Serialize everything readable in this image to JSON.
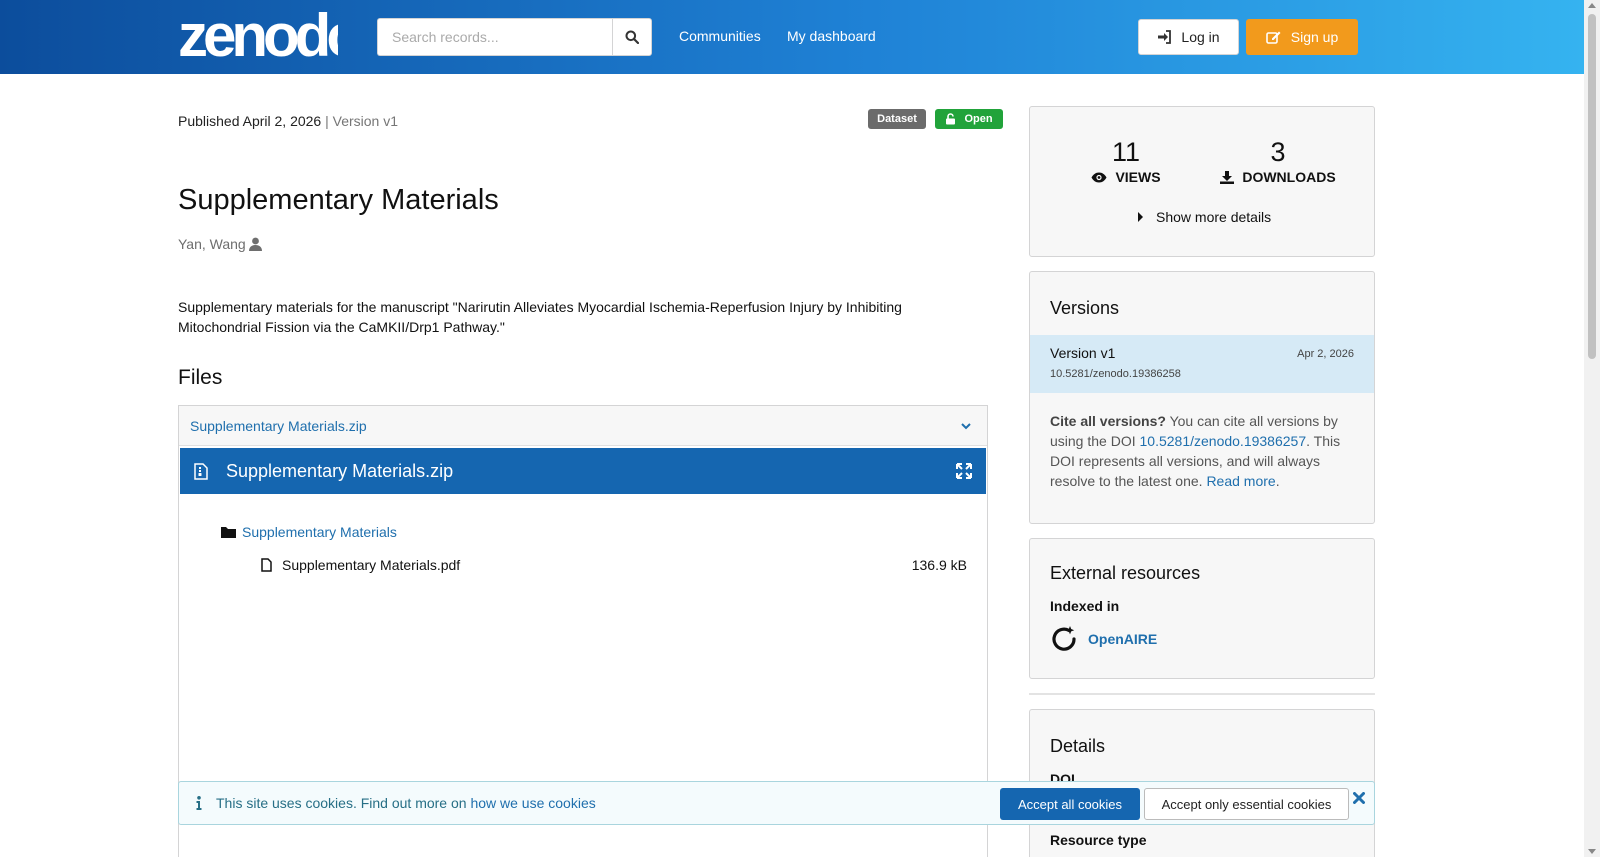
{
  "header": {
    "logo_text": "zenodo",
    "search_placeholder": "Search records...",
    "nav": [
      "Communities",
      "My dashboard"
    ],
    "login_label": "Log in",
    "signup_label": "Sign up"
  },
  "record": {
    "published_label": "Published April 2, 2026",
    "version_label": "| Version v1",
    "type_badge": "Dataset",
    "access_badge": "Open",
    "title": "Supplementary Materials",
    "author": "Yan, Wang",
    "description": "Supplementary materials for the manuscript \"Narirutin Alleviates Myocardial Ischemia-Reperfusion Injury by Inhibiting Mitochondrial Fission via the CaMKII/Drp1 Pathway.\""
  },
  "files": {
    "heading": "Files",
    "archive_name": "Supplementary Materials.zip",
    "preview_title": "Supplementary Materials.zip",
    "folder_name": "Supplementary Materials",
    "file_name": "Supplementary Materials.pdf",
    "file_size": "136.9 kB"
  },
  "stats": {
    "views_count": "11",
    "views_label": "VIEWS",
    "downloads_count": "3",
    "downloads_label": "DOWNLOADS",
    "more_details_label": "Show more details"
  },
  "versions": {
    "heading": "Versions",
    "current_name": "Version v1",
    "current_date": "Apr 2, 2026",
    "current_doi": "10.5281/zenodo.19386258",
    "cite_bold": "Cite all versions?",
    "cite_text_1": " You can cite all versions by using the DOI ",
    "cite_doi": "10.5281/zenodo.19386257",
    "cite_text_2": ". This DOI represents all versions, and will always resolve to the latest one. ",
    "read_more": "Read more",
    "period": "."
  },
  "external": {
    "heading": "External resources",
    "indexed_label": "Indexed in",
    "openaire_label": "OpenAIRE"
  },
  "details": {
    "heading": "Details",
    "doi_label": "DOI",
    "resource_type_label": "Resource type"
  },
  "cookie": {
    "message": "This site uses cookies. Find out more on ",
    "link_text": "how we use cookies",
    "accept_all": "Accept all cookies",
    "accept_essential": "Accept only essential cookies"
  },
  "colors": {
    "header_start": "#0c4d9c",
    "header_end": "#35b3f0",
    "signup": "#f29a1c",
    "open_badge": "#21a33a",
    "dataset_badge": "#6b6b6b",
    "preview_bar": "#1566b0",
    "link": "#1f6fad"
  },
  "icons": [
    "search-icon",
    "login-icon",
    "edit-icon",
    "lock-open-icon",
    "user-icon",
    "chevron-down-icon",
    "file-archive-icon",
    "expand-icon",
    "folder-icon",
    "file-icon",
    "eye-icon",
    "download-icon",
    "caret-right-icon",
    "openaire-icon",
    "info-icon",
    "close-icon"
  ]
}
